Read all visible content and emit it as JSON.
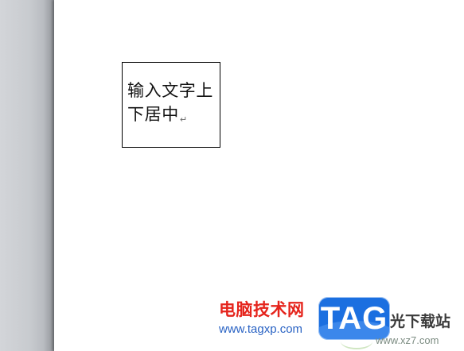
{
  "document": {
    "textbox": {
      "lines": [
        "输入文字上",
        "下居中"
      ],
      "paragraph_mark": "↵"
    }
  },
  "watermark": {
    "site_name": "电脑技术网",
    "site_url": "www.tagxp.com",
    "logo_text": "TAG",
    "partner_name": "光下载站",
    "partner_url": "www.xz7.com"
  },
  "colors": {
    "workspace_gray": "#c8cbcf",
    "page": "#ffffff",
    "textbox_border": "#000000",
    "site_name_red": "#e5241c",
    "site_url_blue": "#2a63c4",
    "logo_blue": "#1b6fe0"
  }
}
